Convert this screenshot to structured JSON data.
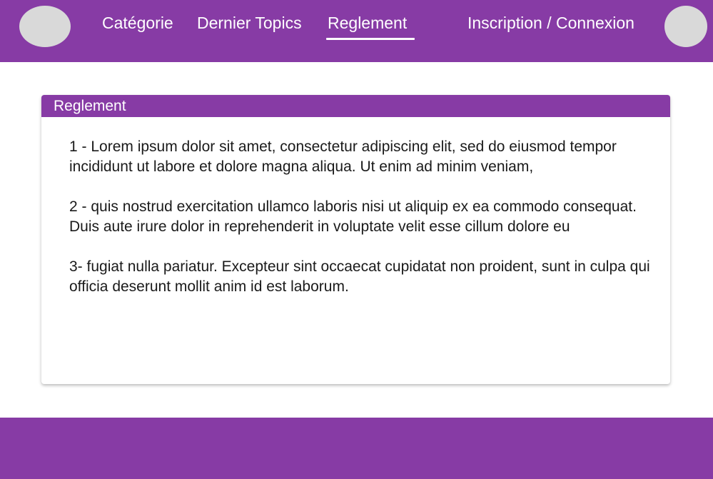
{
  "header": {
    "nav": {
      "categorie": "Catégorie",
      "topics": "Dernier Topics",
      "reglement": "Reglement",
      "auth": "Inscription / Connexion"
    }
  },
  "main": {
    "card_title": "Reglement",
    "rules": [
      "1 - Lorem ipsum dolor sit amet, consectetur adipiscing elit, sed do eiusmod tempor incididunt ut labore et dolore magna aliqua. Ut enim ad minim veniam,",
      "2 - quis nostrud exercitation ullamco laboris nisi ut aliquip ex ea commodo consequat. Duis aute irure dolor in reprehenderit in voluptate velit esse cillum dolore eu",
      "3- fugiat nulla pariatur. Excepteur sint occaecat cupidatat non proident, sunt in culpa qui officia deserunt mollit anim id est laborum."
    ]
  },
  "colors": {
    "brand": "#873ba5",
    "placeholder": "#d9d9d9",
    "text": "#1a1a1a"
  }
}
